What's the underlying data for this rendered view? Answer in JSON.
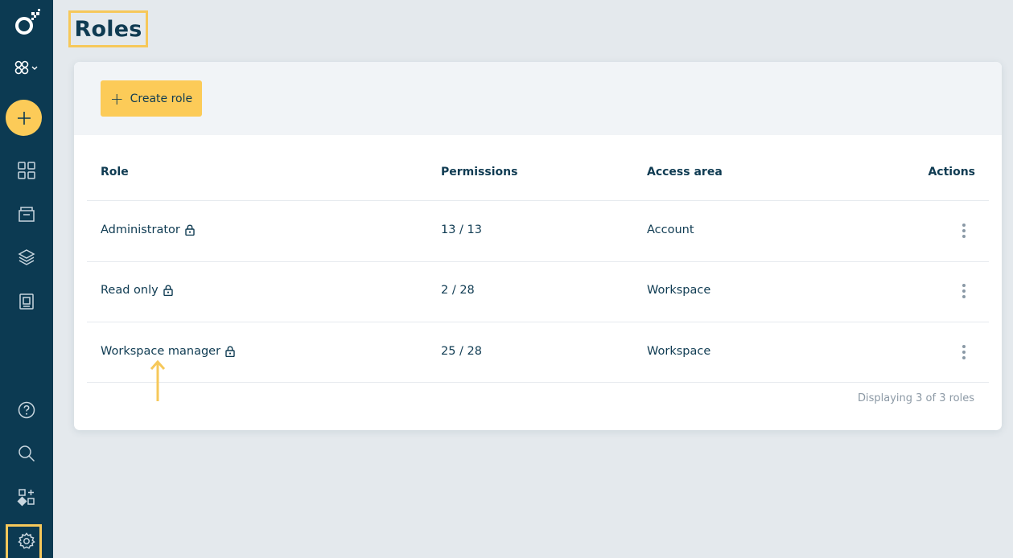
{
  "sidebar": {
    "icons": [
      "logo-icon",
      "workspace-switcher-icon",
      "create-icon",
      "dashboard-icon",
      "folder-icon",
      "layers-icon",
      "contacts-icon",
      "help-icon",
      "search-icon",
      "integrations-icon",
      "settings-icon"
    ]
  },
  "page": {
    "title": "Roles"
  },
  "toolbar": {
    "create_role_label": "Create role"
  },
  "table": {
    "columns": [
      "Role",
      "Permissions",
      "Access area",
      "Actions"
    ],
    "rows": [
      {
        "role": "Administrator",
        "permissions": "13 / 13",
        "access_area": "Account"
      },
      {
        "role": "Read only",
        "permissions": "2 / 28",
        "access_area": "Workspace"
      },
      {
        "role": "Workspace manager",
        "permissions": "25 / 28",
        "access_area": "Workspace"
      }
    ],
    "footer": "Displaying 3 of 3 roles"
  },
  "colors": {
    "sidebar": "#0c3a52",
    "accent": "#fccb58",
    "text": "#0f3b52",
    "background": "#e4e9ed"
  }
}
